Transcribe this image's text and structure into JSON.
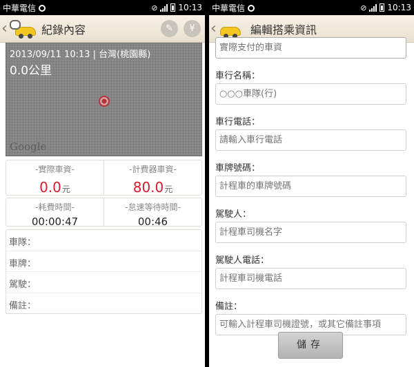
{
  "status_left": {
    "carrier": "中華電信",
    "time": "10:13"
  },
  "status_right": {
    "carrier": "中華電信",
    "time": "10:13"
  },
  "record": {
    "title": "紀錄內容",
    "edit_icon": "pencil-icon",
    "fare_icon": "currency-icon",
    "map": {
      "info": "2013/09/11 10:13 | 台灣(桃園縣)",
      "distance": "0.0公里",
      "logo": "Google"
    },
    "fares": {
      "actual_label": "-實際車資-",
      "actual_value": "0.0",
      "actual_unit": "元",
      "meter_label": "-計費器車資-",
      "meter_value": "80.0",
      "meter_unit": "元"
    },
    "times": {
      "spent_label": "-耗費時間-",
      "spent_value": "00:00:47",
      "idle_label": "-怠速等待時間-",
      "idle_value": "00:46"
    },
    "details": [
      "車隊：",
      "車牌：",
      "駕駛：",
      "備註："
    ]
  },
  "edit": {
    "title": "編輯搭乘資訊",
    "fields": [
      {
        "label": "",
        "placeholder": "實際支付的車資"
      },
      {
        "label": "車行名稱：",
        "placeholder": "○○○車隊(行)"
      },
      {
        "label": "車行電話：",
        "placeholder": "請輸入車行電話"
      },
      {
        "label": "車牌號碼：",
        "placeholder": "計程車的車牌號碼"
      },
      {
        "label": "駕駛人：",
        "placeholder": "計程車司機名字"
      },
      {
        "label": "駕駛人電話：",
        "placeholder": "計程車司機電話"
      },
      {
        "label": "備註：",
        "placeholder": "可輸入計程車司機證號，或其它備註事項"
      }
    ],
    "save_label": "儲存"
  },
  "colors": {
    "fare_red": "#d41c2a",
    "appbar": "#efe8d9",
    "taxi_yellow": "#f3c621"
  }
}
